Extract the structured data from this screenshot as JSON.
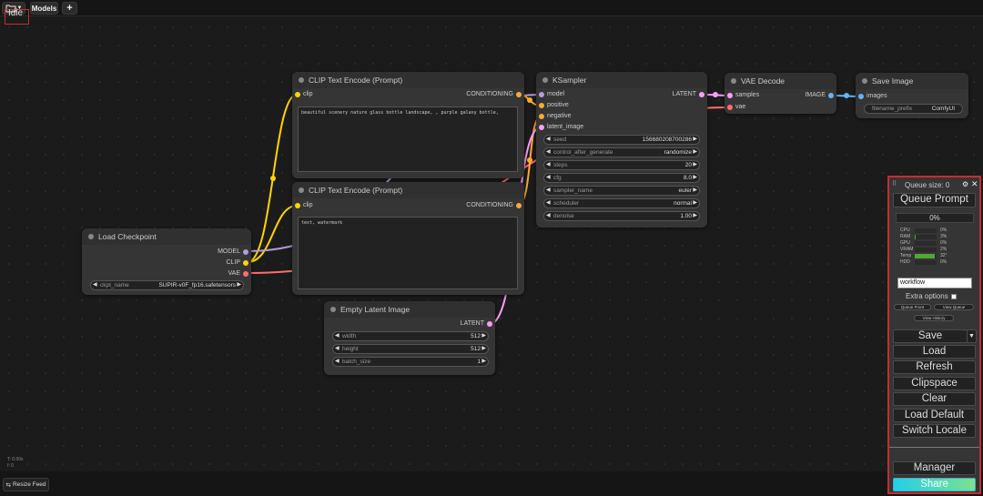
{
  "topbar": {
    "folder_icon": "folder-icon",
    "models_label": "Models",
    "add_label": "+",
    "status": "Idle"
  },
  "nodes": {
    "clip_pos": {
      "title": "CLIP Text Encode (Prompt)",
      "input": "clip",
      "output": "CONDITIONING",
      "text": "beautiful scenery nature glass bottle landscape, , purple galaxy bottle,"
    },
    "clip_neg": {
      "title": "CLIP Text Encode (Prompt)",
      "input": "clip",
      "output": "CONDITIONING",
      "text": "text, watermark"
    },
    "ksampler": {
      "title": "KSampler",
      "inputs": [
        "model",
        "positive",
        "negative",
        "latent_image"
      ],
      "output": "LATENT",
      "widgets": [
        {
          "label": "seed",
          "value": "156680208700286"
        },
        {
          "label": "control_after_generate",
          "value": "randomize"
        },
        {
          "label": "steps",
          "value": "20"
        },
        {
          "label": "cfg",
          "value": "8.0"
        },
        {
          "label": "sampler_name",
          "value": "euler"
        },
        {
          "label": "scheduler",
          "value": "normal"
        },
        {
          "label": "denoise",
          "value": "1.00"
        }
      ]
    },
    "vae_decode": {
      "title": "VAE Decode",
      "inputs": [
        "samples",
        "vae"
      ],
      "output": "IMAGE"
    },
    "save_image": {
      "title": "Save Image",
      "input": "images",
      "widget_label": "filename_prefix",
      "widget_value": "ComfyUI"
    },
    "load_checkpoint": {
      "title": "Load Checkpoint",
      "outputs": [
        "MODEL",
        "CLIP",
        "VAE"
      ],
      "widget_label": "ckpt_name",
      "widget_value": "SUPIR-v0F_fp16.safetensors"
    },
    "empty_latent": {
      "title": "Empty Latent Image",
      "output": "LATENT",
      "widgets": [
        {
          "label": "width",
          "value": "512"
        },
        {
          "label": "height",
          "value": "512"
        },
        {
          "label": "batch_size",
          "value": "1"
        }
      ]
    }
  },
  "panel": {
    "queue_size": "Queue size: 0",
    "queue_prompt": "Queue Prompt",
    "progress": "0%",
    "stats": [
      {
        "label": "CPU",
        "value": "0%",
        "level": 0
      },
      {
        "label": "RAM",
        "value": "3%",
        "level": 0.03
      },
      {
        "label": "GPU",
        "value": "0%",
        "level": 0
      },
      {
        "label": "VRAM",
        "value": "2%",
        "level": 0.02
      },
      {
        "label": "Temp",
        "value": "32°",
        "level": 0.32
      },
      {
        "label": "HDD",
        "value": "0%",
        "level": 0
      }
    ],
    "workflow_value": "workflow",
    "extra_options": "Extra options",
    "queue_front": "Queue Front",
    "view_queue": "View Queue",
    "view_history": "View History",
    "save": "Save",
    "load": "Load",
    "refresh": "Refresh",
    "clipspace": "Clipspace",
    "clear": "Clear",
    "load_default": "Load Default",
    "switch_locale": "Switch Locale",
    "manager": "Manager",
    "share": "Share"
  },
  "footer": {
    "t_line": "T: 0.00s",
    "i_line": "I: 0",
    "resize_feed": "Resize Feed"
  }
}
